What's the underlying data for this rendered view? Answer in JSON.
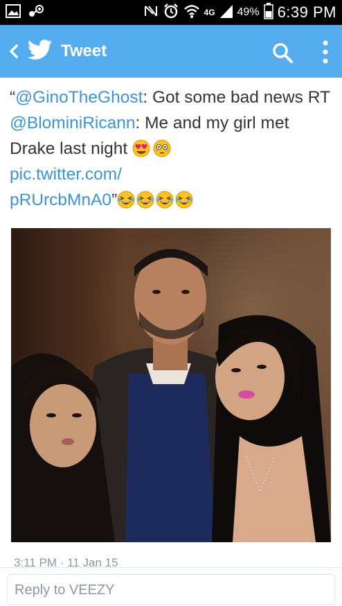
{
  "status_bar": {
    "battery": "49%",
    "time": "6:39 PM",
    "network": "4G"
  },
  "app_bar": {
    "title": "Tweet",
    "icons": [
      "back-icon",
      "twitter-bird-icon",
      "search-icon",
      "overflow-menu-icon"
    ]
  },
  "tweet": {
    "open_quote": "“",
    "mention_1": "@GinoTheGhost",
    "text_1": ": Got some bad news RT ",
    "mention_2": "@BlominiRicann",
    "text_2": ": Me and my girl met Drake last night ",
    "link_1": "pic.twitter.com/",
    "link_2": "pRUrcbMnA0",
    "close_quote": "”",
    "emojis_1": [
      "heart-eyes-emoji",
      "flushed-emoji"
    ],
    "emojis_2": [
      "laughing-emoji",
      "laughing-emoji",
      "laughing-emoji",
      "laughing-emoji"
    ],
    "photo": "photo-three-people",
    "meta": "3:11 PM · 11 Jan 15"
  },
  "reply": {
    "placeholder": "Reply to VEEZY"
  },
  "colors": {
    "twitter_blue": "#55acee",
    "link_blue": "#3b94d9",
    "text": "#333333",
    "meta": "#8899a6"
  }
}
